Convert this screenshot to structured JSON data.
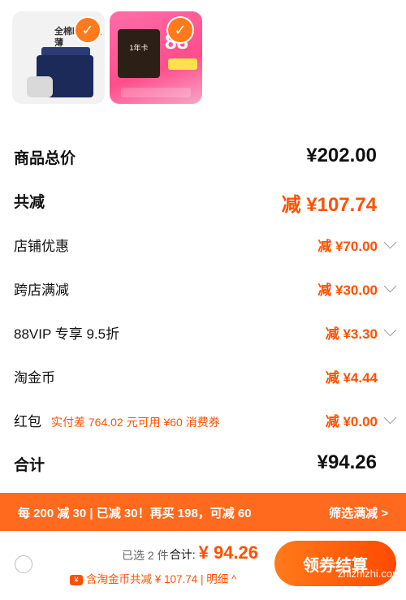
{
  "products": [
    {
      "text": "全棉时代 柔薄",
      "selected": true
    },
    {
      "card_label": "1年卡",
      "promo": "88",
      "selected": true
    }
  ],
  "summary": {
    "goods_total_label": "商品总价",
    "goods_total_value": "¥202.00",
    "total_discount_label": "共减",
    "total_discount_value": "减 ¥107.74",
    "rows": [
      {
        "label": "店铺优惠",
        "value": "减 ¥70.00",
        "chevron": true
      },
      {
        "label": "跨店满减",
        "value": "减 ¥30.00",
        "chevron": true
      },
      {
        "label": "88VIP 专享 9.5折",
        "value": "减 ¥3.30",
        "chevron": true
      },
      {
        "label": "淘金币",
        "value": "减 ¥4.44",
        "chevron": false
      },
      {
        "label": "红包",
        "hint": "实付差 764.02 元可用 ¥60 消费券",
        "value": "减 ¥0.00",
        "chevron": true
      }
    ],
    "sum_label": "合计",
    "sum_value": "¥94.26"
  },
  "banner": {
    "left_text": "每 200 减 30 | 已减 30！再买 198，可减 60",
    "right_text": "筛选满减 >"
  },
  "footer": {
    "selected_count": "已选 2 件",
    "total_label": "合计:",
    "total_value": "¥ 94.26",
    "coin_line": "含淘金币共减 ¥ 107.74 | 明细 ^",
    "settle_label": "领券结算"
  },
  "watermark": "zhizhizhi.com",
  "colors": {
    "accent": "#ff5000",
    "banner": "#ff6a1f"
  }
}
